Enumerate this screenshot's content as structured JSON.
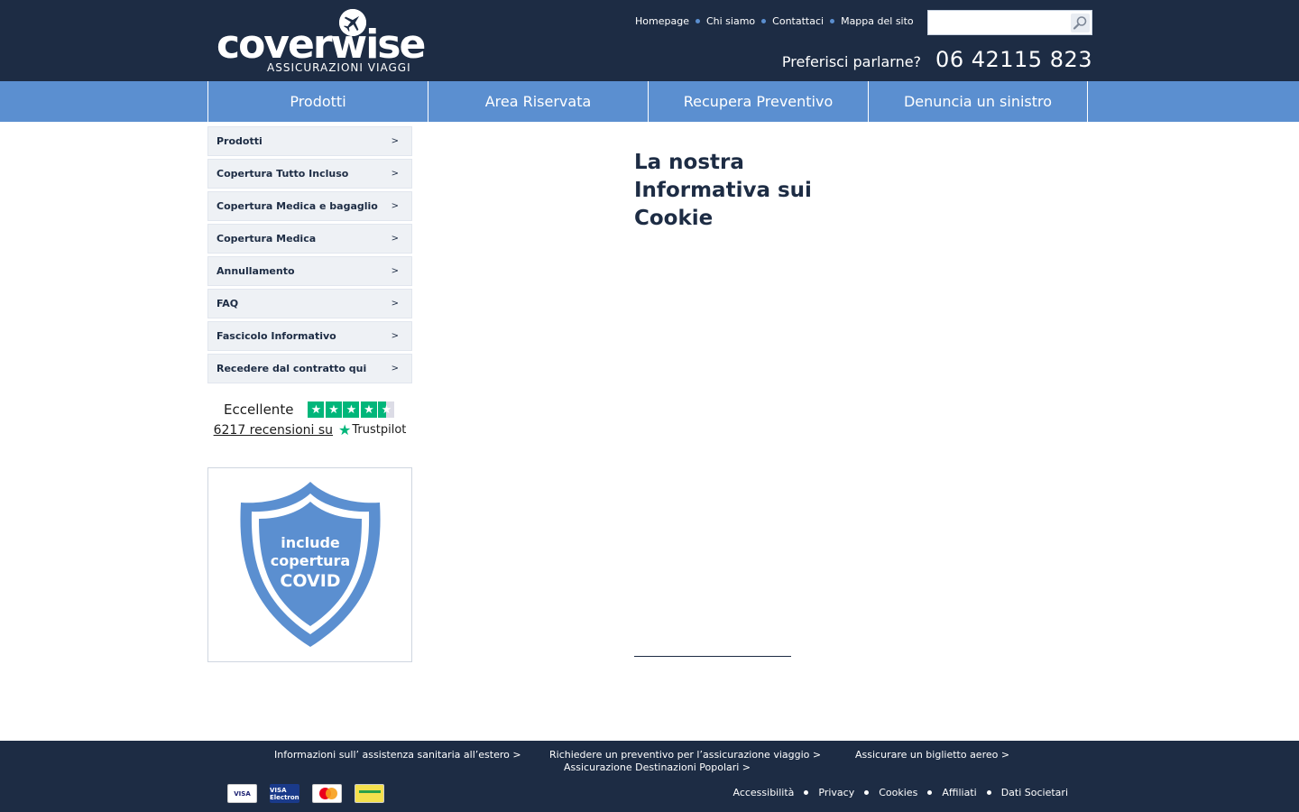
{
  "brand": {
    "logo_main": "cover",
    "logo_accent": "wise",
    "logo_sub": "ASSICURAZIONI VIAGGI"
  },
  "header": {
    "top_links": [
      "Homepage",
      "Chi siamo",
      "Contattaci",
      "Mappa del sito"
    ],
    "search": {
      "placeholder": "",
      "value": ""
    },
    "phone_label": "Preferisci parlarne?",
    "phone_number": "06 42115 823"
  },
  "nav": {
    "items": [
      "Prodotti",
      "Area Riservata",
      "Recupera Preventivo",
      "Denuncia un sinistro"
    ]
  },
  "sidebar": {
    "items": [
      "Prodotti",
      "Copertura Tutto Incluso",
      "Copertura Medica e bagaglio",
      "Copertura Medica",
      "Annullamento",
      "FAQ",
      "Fascicolo Informativo",
      "Recedere dal contratto qui"
    ],
    "chevron": ">"
  },
  "trustpilot": {
    "rating_label": "Eccellente",
    "reviews_link": "6217 recensioni su",
    "brand": "Trustpilot",
    "stars": 4.5
  },
  "covid_badge": {
    "line1": "include",
    "line2": "copertura",
    "line3": "COVID"
  },
  "main": {
    "title": "La nostra Informativa sui Cookie"
  },
  "footer": {
    "links": [
      "Informazioni sull’ assistenza sanitaria all’estero >",
      "Richiedere un preventivo per l’assicurazione viaggio >",
      "Assicurare un biglietto aereo >",
      "Assicurazione Destinazioni Popolari >"
    ],
    "cards": [
      "VISA",
      "VISA Electron"
    ],
    "legal": [
      "Accessibilità",
      "Privacy",
      "Cookies",
      "Affiliati",
      "Dati Societari"
    ]
  },
  "colors": {
    "header_bg": "#1d2c44",
    "nav_bg": "#5b8fd0",
    "shield_blue": "#5b8fd0"
  }
}
